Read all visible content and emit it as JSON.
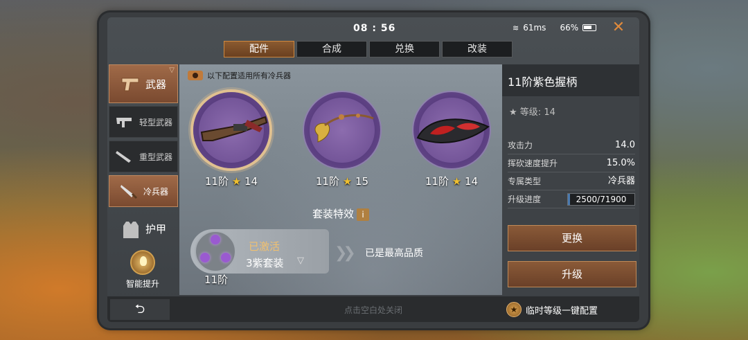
{
  "status": {
    "time": "08 : 56",
    "signal": "61ms",
    "battery": "66%"
  },
  "tabs": [
    {
      "label": "配件",
      "active": true
    },
    {
      "label": "合成",
      "active": false
    },
    {
      "label": "兑换",
      "active": false
    },
    {
      "label": "改装",
      "active": false
    }
  ],
  "sidebar": {
    "weapons": "武器",
    "light": "轻型武器",
    "heavy": "重型武器",
    "melee": "冷兵器",
    "armor": "护甲",
    "smart": "智能提升"
  },
  "notice": "以下配置适用所有冷兵器",
  "slots": [
    {
      "tier": "11阶",
      "stars": "14",
      "icon": "crossbow-grip-icon"
    },
    {
      "tier": "11阶",
      "stars": "15",
      "icon": "tassel-icon"
    },
    {
      "tier": "11阶",
      "stars": "14",
      "icon": "blade-guard-icon"
    }
  ],
  "set": {
    "title": "套装特效",
    "info": "i",
    "status": "已激活",
    "name": "3紫套装",
    "tier": "11阶",
    "max": "已是最高品质"
  },
  "detail": {
    "title": "11阶紫色握柄",
    "level_label": "等级:",
    "level": "14",
    "stats": [
      {
        "label": "攻击力",
        "value": "14.0"
      },
      {
        "label": "挥砍速度提升",
        "value": "15.0%"
      },
      {
        "label": "专属类型",
        "value": "冷兵器"
      }
    ],
    "progress_label": "升级进度",
    "progress_text": "2500/71900",
    "progress_fraction": 0.035,
    "replace": "更换",
    "upgrade": "升级"
  },
  "bottom": {
    "back": "⮌",
    "hint": "点击空白处关闭",
    "config": "临时等级一键配置"
  },
  "colors": {
    "accent": "#c08a58",
    "purple": "#6a4c90",
    "star": "#f0c030"
  }
}
